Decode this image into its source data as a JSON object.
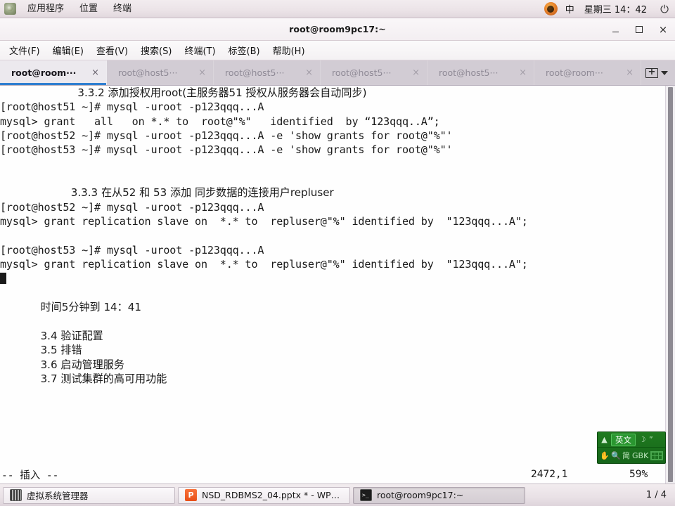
{
  "desktop_panel": {
    "menus": [
      "应用程序",
      "位置",
      "终端"
    ],
    "tray": {
      "ime_label": "中",
      "clock": "星期三 14：42",
      "power_icon": "power-icon",
      "browser_icon": "firefox-icon"
    }
  },
  "terminal_window": {
    "title": "root@room9pc17:~",
    "window_buttons": {
      "minimize": "minimize-icon",
      "maximize": "maximize-icon",
      "close": "×"
    },
    "menubar": [
      "文件(F)",
      "编辑(E)",
      "查看(V)",
      "搜索(S)",
      "终端(T)",
      "标签(B)",
      "帮助(H)"
    ],
    "tabs": [
      {
        "label": "root@room···",
        "active": true
      },
      {
        "label": "root@host5···",
        "active": false
      },
      {
        "label": "root@host5···",
        "active": false
      },
      {
        "label": "root@host5···",
        "active": false
      },
      {
        "label": "root@host5···",
        "active": false
      },
      {
        "label": "root@room···",
        "active": false
      }
    ],
    "tab_close_glyph": "×",
    "tabbar_actions": {
      "new_tab": "new-tab-icon",
      "tab_list": "chevron-down-icon"
    }
  },
  "terminal_content": {
    "lines": [
      {
        "text": "                       3.3.2 添加授权用root(主服务器51 授权从服务器会自动同步)",
        "cjk": true
      },
      {
        "text": "[root@host51 ~]# mysql -uroot -p123qqq...A",
        "cjk": false
      },
      {
        "text": "mysql> grant   all   on *.* to  root@\"%\"   identified  by “123qqq..A”;",
        "cjk": false
      },
      {
        "text": "[root@host52 ~]# mysql -uroot -p123qqq...A -e 'show grants for root@\"%\"'",
        "cjk": false
      },
      {
        "text": "[root@host53 ~]# mysql -uroot -p123qqq...A -e 'show grants for root@\"%\"'",
        "cjk": false
      },
      {
        "text": "",
        "cjk": false
      },
      {
        "text": "",
        "cjk": false
      },
      {
        "text": "                     3.3.3 在从52 和 53 添加 同步数据的连接用户repluser",
        "cjk": true
      },
      {
        "text": "[root@host52 ~]# mysql -uroot -p123qqq...A",
        "cjk": false
      },
      {
        "text": "mysql> grant replication slave on  *.* to  repluser@\"%\" identified by  \"123qqq...A\";",
        "cjk": false
      },
      {
        "text": "",
        "cjk": false
      },
      {
        "text": "[root@host53 ~]# mysql -uroot -p123qqq...A",
        "cjk": false
      },
      {
        "text": "mysql> grant replication slave on  *.* to  repluser@\"%\" identified by  \"123qqq...A\";",
        "cjk": false
      },
      {
        "text": "CURSOR",
        "cjk": false
      },
      {
        "text": "",
        "cjk": false
      },
      {
        "text": "            时间5分钟到 14：41",
        "cjk": true
      },
      {
        "text": "",
        "cjk": true
      },
      {
        "text": "            3.4 验证配置",
        "cjk": true
      },
      {
        "text": "            3.5 排错",
        "cjk": true
      },
      {
        "text": "            3.6 启动管理服务",
        "cjk": true
      },
      {
        "text": "            3.7 测试集群的高可用功能",
        "cjk": true
      }
    ]
  },
  "vim_status": {
    "mode": "-- 插入 --",
    "position": "2472,1",
    "percent": "59%"
  },
  "ime_panel": {
    "mode_label": "英文",
    "up_glyph": "▲",
    "moon_glyph": "☽",
    "quote_glyph": "”",
    "hand_glyph": "✋",
    "search_glyph": "search-icon",
    "script_label": "简",
    "encoding_label": "GBK"
  },
  "taskbar": {
    "buttons": [
      {
        "label": "虚拟系统管理器",
        "icon": "virtual-machine-manager-icon",
        "active": false
      },
      {
        "label": "NSD_RDBMS2_04.pptx * - WPS ...",
        "icon": "wps-presentation-icon",
        "active": false
      },
      {
        "label": "root@room9pc17:~",
        "icon": "terminal-icon",
        "active": true
      }
    ],
    "workspace": "1 / 4"
  }
}
